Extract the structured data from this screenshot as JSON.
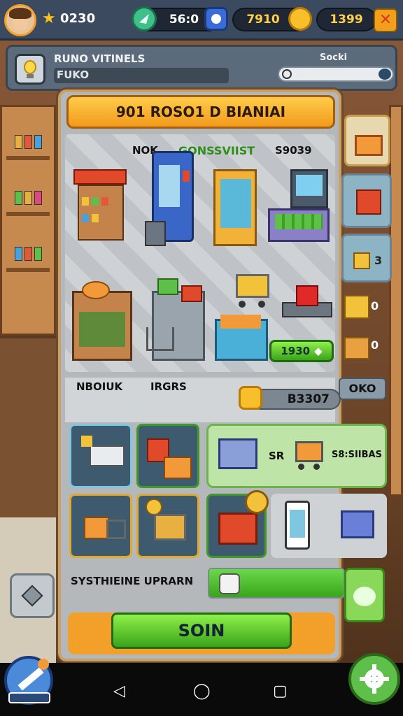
{
  "topbar": {
    "star_count": "0230",
    "gems": "56:0",
    "coins": "7910",
    "cash": "1399"
  },
  "header": {
    "title": "RUNO VITINELS",
    "subtitle": "FUKO",
    "right_label": "Socki"
  },
  "panel": {
    "banner_title": "901 ROSO1 D BIANIAI",
    "floor_labels": {
      "left": "NOK",
      "center": "GONSSVIIST",
      "right": "S9039"
    },
    "buy_price": "1930",
    "section_label_left": "NBOIUK",
    "section_label_right": "IRGRS",
    "coin_total": "B3307",
    "side_tag": "OKO",
    "combo_left": "SR",
    "combo_right": "S8:SIIBAS",
    "upgrade_label": "SYSTHIEINE UPRARN",
    "spin_button": "SOIN"
  },
  "side_rail": {
    "badge_a": "3",
    "count_b": "0",
    "count_c": "0"
  },
  "bottom": {
    "left_badge": ""
  },
  "colors": {
    "accent_orange": "#f29a1c",
    "accent_green": "#3aa41a",
    "panel_gray": "#b4b8bb"
  },
  "icons": [
    "star-icon",
    "gem-icon",
    "clock-icon",
    "coin-icon",
    "close-icon",
    "lightbulb-icon",
    "search-icon",
    "cart-icon",
    "truck-icon",
    "phone-icon",
    "gear-icon",
    "rocket-icon"
  ]
}
